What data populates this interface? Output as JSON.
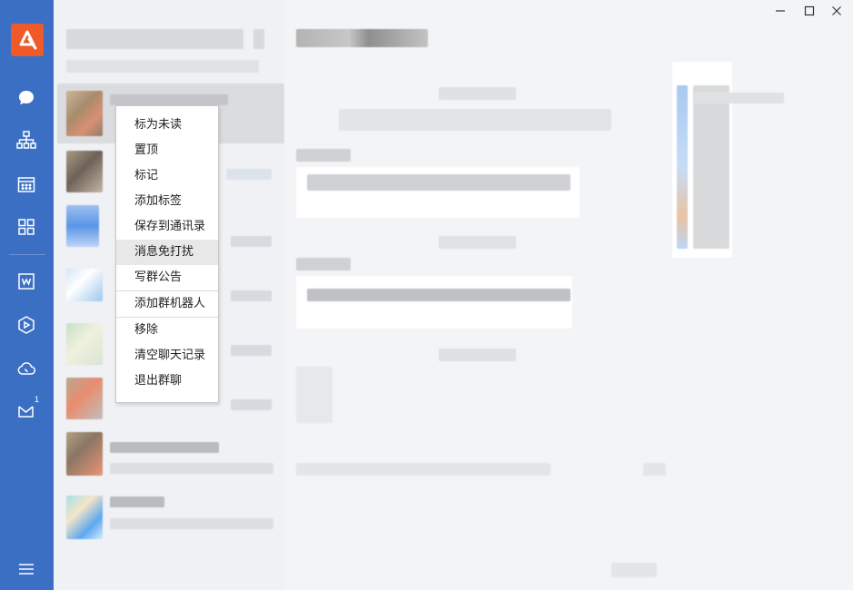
{
  "window": {
    "minimize_glyph": "—",
    "maximize_glyph": "☐",
    "close_glyph": "✕"
  },
  "rail": {
    "items": [
      {
        "name": "chat-icon"
      },
      {
        "name": "org-chart-icon"
      },
      {
        "name": "calendar-icon"
      },
      {
        "name": "apps-grid-icon"
      },
      {
        "name": "document-icon"
      },
      {
        "name": "cube-icon"
      },
      {
        "name": "cloud-phone-icon"
      },
      {
        "name": "mail-icon",
        "badge": "1"
      },
      {
        "name": "menu-icon"
      }
    ]
  },
  "context_menu": {
    "items": [
      {
        "label": "标为未读"
      },
      {
        "label": "置顶"
      },
      {
        "label": "标记"
      },
      {
        "label": "添加标签"
      },
      {
        "label": "保存到通讯录"
      },
      {
        "label": "消息免打扰"
      },
      {
        "label": "写群公告"
      },
      {
        "label": "添加群机器人"
      },
      {
        "label": "移除"
      },
      {
        "label": "清空聊天记录"
      },
      {
        "label": "退出群聊"
      }
    ],
    "hovered_index": 5
  },
  "colors": {
    "rail": "#3a6fc4",
    "logo": "#f05a28",
    "list_bg": "#eff1f4",
    "main_bg": "#f3f4f6"
  }
}
